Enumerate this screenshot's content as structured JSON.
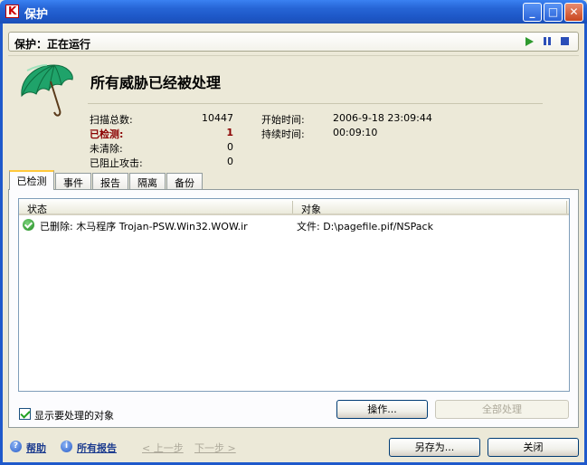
{
  "window": {
    "title": "保护",
    "app_icon_letter": "K",
    "min_glyph": "_",
    "max_glyph": "□",
    "close_glyph": "✕"
  },
  "statusbar": {
    "text": "保护：正在运行"
  },
  "summary": {
    "headline": "所有威胁已经被处理",
    "stats_left": [
      {
        "label": "扫描总数:",
        "value": "10447"
      },
      {
        "label": "已检测:",
        "value": "1"
      },
      {
        "label": "未清除:",
        "value": "0"
      },
      {
        "label": "已阻止攻击:",
        "value": "0"
      }
    ],
    "stats_right": [
      {
        "label": "开始时间:",
        "value": "2006-9-18 23:09:44"
      },
      {
        "label": "持续时间:",
        "value": "00:09:10"
      }
    ]
  },
  "tabs": [
    {
      "label": "已检测",
      "active": true
    },
    {
      "label": "事件"
    },
    {
      "label": "报告"
    },
    {
      "label": "隔离"
    },
    {
      "label": "备份"
    }
  ],
  "list": {
    "columns": [
      "状态",
      "对象"
    ],
    "rows": [
      {
        "status": "已删除: 木马程序 Trojan-PSW.Win32.WOW.ir",
        "object": "文件: D:\\pagefile.pif/NSPack"
      }
    ]
  },
  "show_items": {
    "label": "显示要处理的对象",
    "checked": true
  },
  "buttons": {
    "action": "操作...",
    "process_all": "全部处理",
    "save_as": "另存为...",
    "close": "关闭"
  },
  "footer": {
    "help": "帮助",
    "all_reports": "所有报告",
    "prev": "< 上一步",
    "next": "下一步 >"
  },
  "colors": {
    "titlebar": "#2665D6",
    "detected_red": "#8B0000",
    "ok_green": "#1D8A1D",
    "umbrella_green": "#1FA36A"
  }
}
